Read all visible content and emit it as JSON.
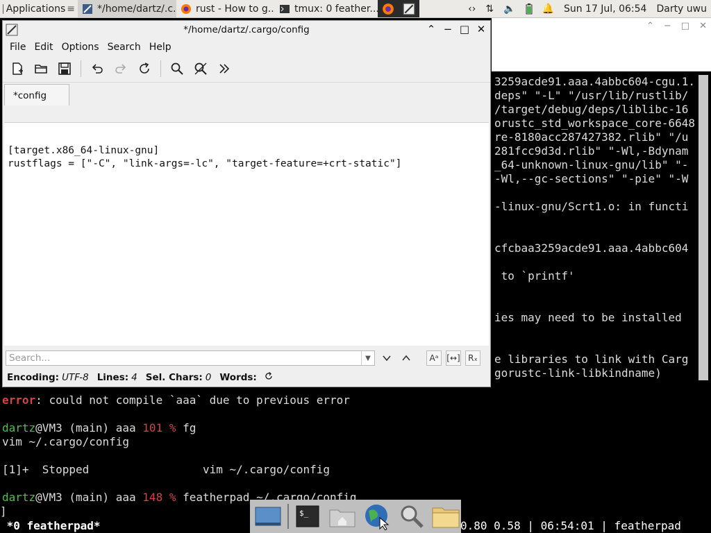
{
  "top_panel": {
    "applications_label": "Applications",
    "tasks": [
      {
        "label": "*/home/dartz/.c..."
      },
      {
        "label": "rust - How to g..."
      },
      {
        "label": "tmux: 0 feather..."
      }
    ],
    "clock": "Sun 17 Jul, 06:54",
    "user": "Darty uwu"
  },
  "featherpad": {
    "title": "*/home/dartz/.cargo/config",
    "menu": [
      "File",
      "Edit",
      "Options",
      "Search",
      "Help"
    ],
    "tab_label": "*config",
    "lines": [
      "",
      "[target.x86_64-linux-gnu]",
      "rustflags = [\"-C\", \"link-args=-lc\", \"target-feature=+crt-static\"]"
    ],
    "search_placeholder": "Search...",
    "status": {
      "encoding_label": "Encoding:",
      "encoding_value": "UTF-8",
      "lines_label": "Lines:",
      "lines_value": "4",
      "sel_label": "Sel. Chars:",
      "sel_value": "0",
      "words_label": "Words:"
    }
  },
  "terminal": {
    "right_lines": [
      "3259acde91.aaa.4abbc604-cgu.1.",
      "deps\" \"-L\" \"/usr/lib/rustlib/",
      "/target/debug/deps/liblibc-16",
      "orustc_std_workspace_core-6648",
      "re-8180acc287427382.rlib\" \"/u",
      "281fcc9d3d.rlib\" \"-Wl,-Bdynam",
      "_64-unknown-linux-gnu/lib\" \"-",
      "-Wl,--gc-sections\" \"-pie\" \"-W",
      "",
      "-linux-gnu/Scrt1.o: in functi",
      "",
      "",
      "cfcbaa3259acde91.aaa.4abbc604",
      "",
      " to `printf'",
      "",
      "",
      "ies may need to be installed",
      "",
      "",
      "e libraries to link with Carg",
      "gorustc-link-libkindname)"
    ],
    "error_prefix": "error",
    "error_text": ": could not compile `aaa` due to previous error",
    "prompt1_user": "dartz",
    "prompt1_host": "@VM3 (main) aaa ",
    "prompt1_code": "101",
    "prompt1_sym": " % ",
    "prompt1_cmd": "fg",
    "vim_line": "vim ~/.cargo/config",
    "stopped_line": "[1]+  Stopped                 vim ~/.cargo/config",
    "prompt2_user": "dartz",
    "prompt2_host": "@VM3 (main) aaa ",
    "prompt2_code": "148",
    "prompt2_sym": " % ",
    "prompt2_cmd": "featherpad ~/.cargo/config",
    "cursor": "]",
    "status_left": " *0 featherpad*",
    "status_right": "0.80 0.58 | 06:54:01 | featherpad "
  },
  "colors": {
    "error_red": "#d34545",
    "prompt_green": "#4fbf4f",
    "panel_bg": "#eceae7"
  }
}
